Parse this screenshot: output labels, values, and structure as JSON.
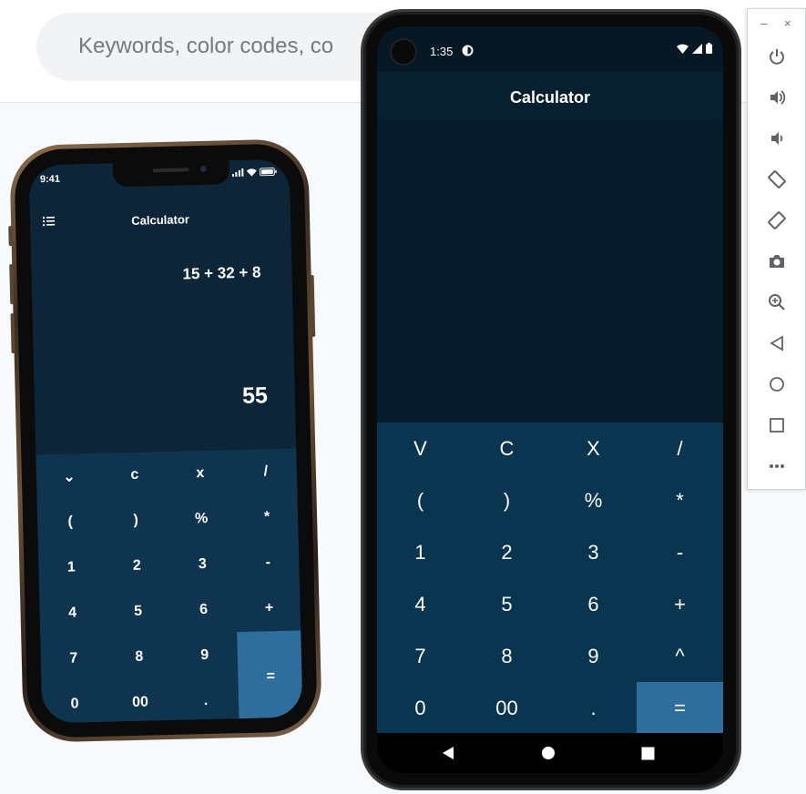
{
  "search": {
    "placeholder": "Keywords, color codes, co"
  },
  "iphone": {
    "status_time": "9:41",
    "title": "Calculator",
    "expression": "15 + 32 + 8",
    "result": "55",
    "keys": [
      [
        "⌄",
        "c",
        "x",
        "/"
      ],
      [
        "(",
        ")",
        "%",
        "*"
      ],
      [
        "1",
        "2",
        "3",
        "-"
      ],
      [
        "4",
        "5",
        "6",
        "+"
      ],
      [
        "7",
        "8",
        "9",
        "="
      ],
      [
        "0",
        "00",
        "."
      ]
    ]
  },
  "android": {
    "status_time": "1:35",
    "title": "Calculator",
    "keys": [
      [
        "V",
        "C",
        "X",
        "/"
      ],
      [
        "(",
        ")",
        "%",
        "*"
      ],
      [
        "1",
        "2",
        "3",
        "-"
      ],
      [
        "4",
        "5",
        "6",
        "+"
      ],
      [
        "7",
        "8",
        "9",
        "^"
      ],
      [
        "0",
        "00",
        ".",
        "="
      ]
    ]
  },
  "emulator_toolbar": {
    "minimize": "–",
    "close": "×",
    "buttons": [
      "power-icon",
      "volume-up-icon",
      "volume-down-icon",
      "rotate-left-icon",
      "rotate-right-icon",
      "camera-icon",
      "zoom-icon",
      "back-icon",
      "home-icon",
      "overview-icon",
      "more-icon"
    ]
  },
  "colors": {
    "screen_bg": "#061c2b",
    "pad_bg": "#093550",
    "equals_bg": "#2f6d9c",
    "ios_bg": "#0d2538"
  }
}
